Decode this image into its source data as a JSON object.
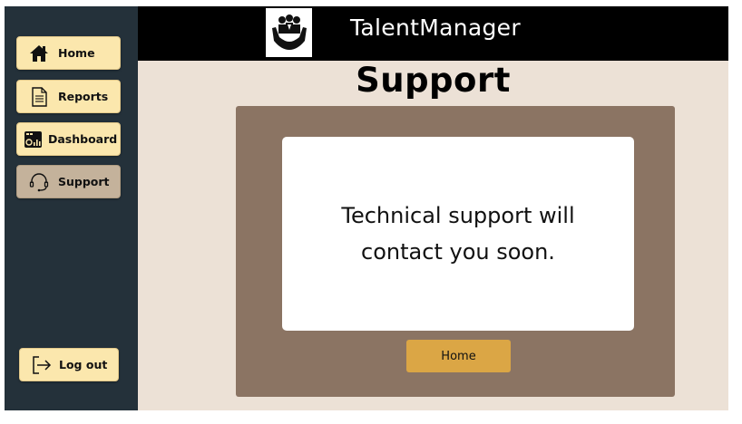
{
  "app": {
    "title": "TalentManager"
  },
  "sidebar": {
    "items": [
      {
        "label": "Home",
        "icon": "house-icon"
      },
      {
        "label": "Reports",
        "icon": "document-icon"
      },
      {
        "label": "Dashboard",
        "icon": "dashboard-icon"
      },
      {
        "label": "Support",
        "icon": "headset-icon",
        "active": true
      }
    ],
    "logout_label": "Log out"
  },
  "page": {
    "title": "Support",
    "message": "Technical support will contact you soon.",
    "home_button_label": "Home"
  },
  "colors": {
    "sidebar_bg": "#24313a",
    "nav_button_bg": "#fbe7ad",
    "nav_active_bg": "#c4b29b",
    "page_bg": "#ece1d6",
    "panel_bg": "#8b7463",
    "primary_button": "#dba645",
    "topbar_bg": "#000000"
  }
}
